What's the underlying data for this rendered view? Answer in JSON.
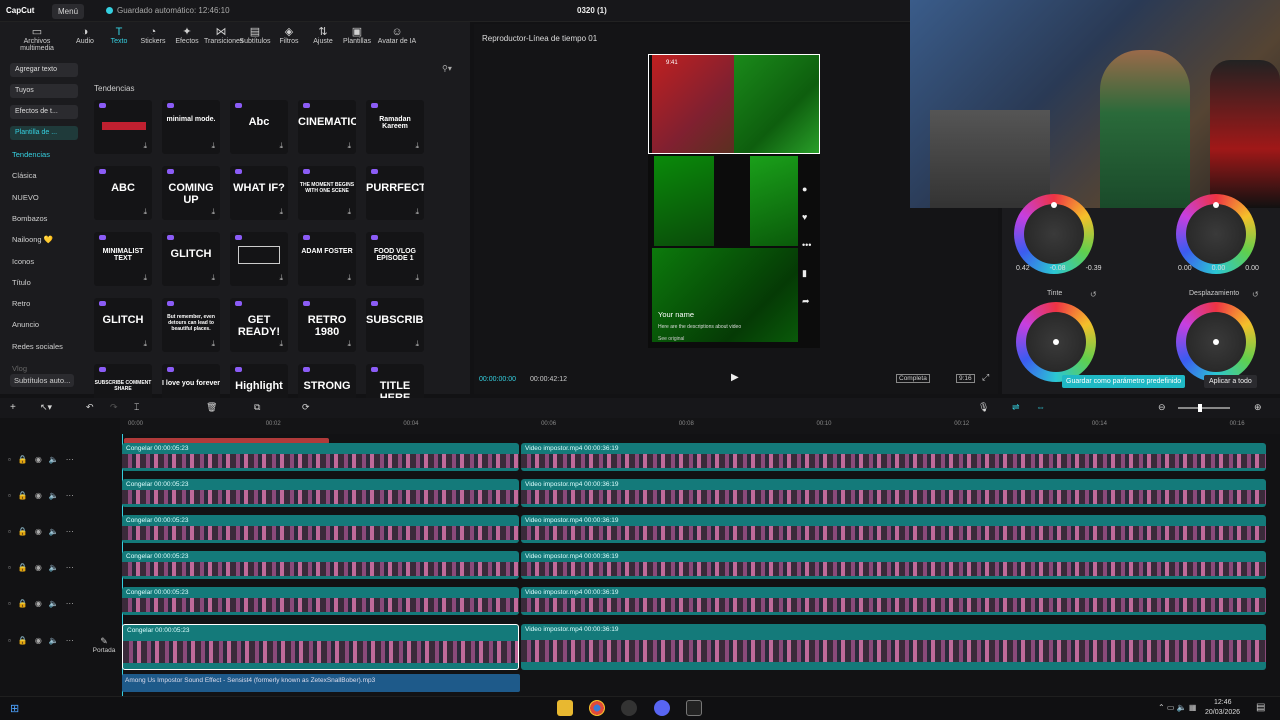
{
  "app": {
    "logo": "CapCut",
    "menu": "Menú",
    "autosave": "Guardado automático: 12:46:10",
    "project": "0320 (1)"
  },
  "tabs": [
    {
      "icon": "▭",
      "label": "Archivos multimedia"
    },
    {
      "icon": "◑",
      "label": "Audio"
    },
    {
      "icon": "T",
      "label": "Texto",
      "active": true
    },
    {
      "icon": "◔",
      "label": "Stickers"
    },
    {
      "icon": "✦",
      "label": "Efectos"
    },
    {
      "icon": "⋈",
      "label": "Transiciones"
    },
    {
      "icon": "▤",
      "label": "Subtítulos"
    },
    {
      "icon": "◈",
      "label": "Filtros"
    },
    {
      "icon": "⇅",
      "label": "Ajuste"
    },
    {
      "icon": "▣",
      "label": "Plantillas"
    },
    {
      "icon": "☺",
      "label": "Avatar de IA"
    }
  ],
  "leftnav": {
    "buttons": [
      "Agregar texto",
      "Tuyos",
      "Efectos de t...",
      "Plantilla de ..."
    ],
    "items": [
      "Tendencias",
      "Clásica",
      "NUEVO",
      "Bombazos",
      "Nailoong 💛",
      "Iconos",
      "Título",
      "Retro",
      "Anuncio",
      "Redes sociales",
      "Vlog",
      "Subtítulos auto..."
    ]
  },
  "stickers": {
    "section": "Tendencias",
    "tiles": [
      "",
      "minimal mode.",
      "Abc",
      "CINEMATIC",
      "Ramadan Kareem",
      "ABC",
      "COMING UP",
      "WHAT IF?",
      "THE MOMENT BEGINS WITH ONE SCENE",
      "PURRFECT",
      "MINIMALIST TEXT",
      "GLITCH",
      "",
      "ADAM FOSTER",
      "FOOD VLOG EPISODE 1",
      "GLITCH",
      "But remember, even detours can lead to beautiful places.",
      "GET READY!",
      "RETRO 1980",
      "SUBSCRIBE",
      "SUBSCRIBE COMMENT SHARE",
      "I love you forever",
      "Highlight",
      "STRONG",
      "TITLE HERE"
    ]
  },
  "player": {
    "title": "Reproductor-Línea de tiempo 01",
    "current": "00:00:00:00",
    "total": "00:00:42:12",
    "full": "Completa",
    "ratio": "9:16",
    "phone_time": "9:41",
    "name": "Your name",
    "desc": "Here are the descriptions about video",
    "original": "See original"
  },
  "color": {
    "tinte": "Tinte",
    "desp": "Desplazamiento",
    "v1": [
      "0.42",
      "-0.08",
      "-0.39"
    ],
    "v2": [
      "0.00",
      "0.00",
      "0.00"
    ],
    "save": "Guardar como parámetro predefinido",
    "apply": "Aplicar a todo"
  },
  "ruler": [
    "00:00",
    "00:02",
    "00:04",
    "00:06",
    "00:08",
    "00:10",
    "00:12",
    "00:14",
    "00:16"
  ],
  "tracks": [
    {
      "a": "Congelar  00:00:05:23",
      "b": "Video impostor.mp4  00:00:36:19"
    },
    {
      "a": "Congelar  00:00:05:23",
      "b": "Video impostor.mp4  00:00:36:19"
    },
    {
      "a": "Congelar  00:00:05:23",
      "b": "Video impostor.mp4  00:00:36:19"
    },
    {
      "a": "Congelar  00:00:05:23",
      "b": "Video impostor.mp4  00:00:36:19"
    },
    {
      "a": "Congelar  00:00:05:23",
      "b": "Video impostor.mp4  00:00:36:19"
    },
    {
      "a": "Congelar  00:00:05:23",
      "b": "Video impostor.mp4  00:00:36:19"
    }
  ],
  "cover": "Portada",
  "audio": "Among Us Impostor Sound Effect - Sensist4 (formerly known as ZetexSnallBober).mp3",
  "taskbar": {
    "time": "12:46",
    "date": "20/03/2026"
  },
  "colors": {
    "accent": "#35d0e0",
    "clip": "#147a7a",
    "audio": "#1e5a8a"
  }
}
